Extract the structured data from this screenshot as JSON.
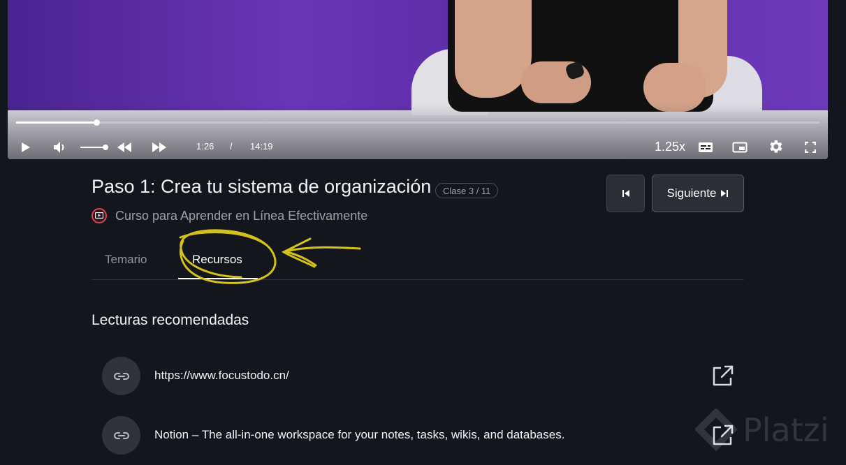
{
  "player": {
    "current_time": "1:26",
    "separator": "/",
    "duration": "14:19",
    "progress_fraction": 0.1,
    "volume_fraction": 0.9,
    "speed": "1.25x",
    "icons": [
      "play-icon",
      "volume-icon",
      "rewind-icon",
      "forward-icon",
      "subtitles-icon",
      "picture-in-picture-icon",
      "settings-icon",
      "fullscreen-icon"
    ]
  },
  "lesson": {
    "title": "Paso 1: Crea tu sistema de organización",
    "badge": "Clase 3 / 11",
    "course_name": "Curso para Aprender en Línea Efectivamente",
    "prev_icon": "skip-previous-icon",
    "next_label": "Siguiente"
  },
  "tabs": [
    {
      "label": "Temario",
      "active": false
    },
    {
      "label": "Recursos",
      "active": true
    }
  ],
  "resources": {
    "section_title": "Lecturas recomendadas",
    "items": [
      {
        "label": "https://www.focustodo.cn/",
        "icon": "link-icon"
      },
      {
        "label": "Notion – The all-in-one workspace for your notes, tasks, wikis, and databases.",
        "icon": "link-icon"
      }
    ]
  },
  "colors": {
    "background": "#13161c",
    "highlight_annotation": "#d4c21a",
    "badge_border": "#4a4f5b",
    "course_icon": "#e0424f"
  },
  "watermark": "Platzi"
}
